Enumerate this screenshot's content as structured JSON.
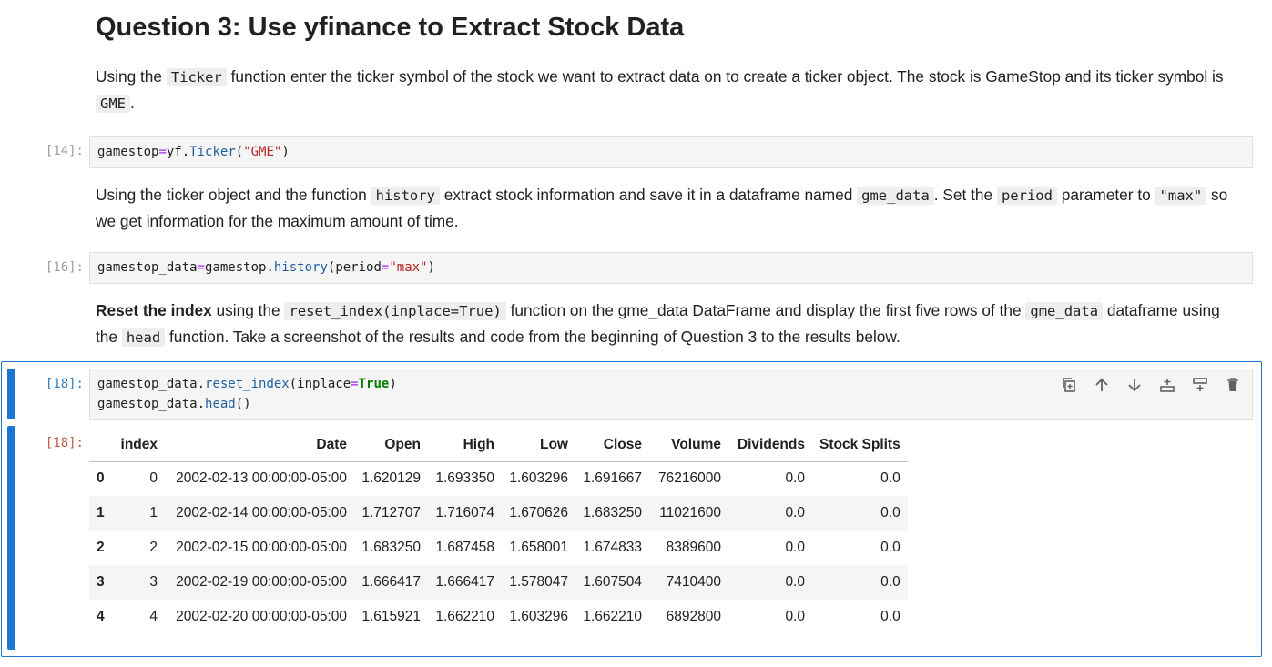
{
  "heading": "Question 3: Use yfinance to Extract Stock Data",
  "para1": {
    "t1": "Using the ",
    "c1": "Ticker",
    "t2": " function enter the ticker symbol of the stock we want to extract data on to create a ticker object. The stock is GameStop and its ticker symbol is ",
    "c2": "GME",
    "t3": "."
  },
  "cell14": {
    "prompt": "[14]:",
    "code": {
      "a": "gamestop",
      "op": "=",
      "b": "yf.",
      "attr": "Ticker",
      "c": "(",
      "str": "\"GME\"",
      "d": ")"
    }
  },
  "para2": {
    "t1": "Using the ticker object and the function ",
    "c1": "history",
    "t2": " extract stock information and save it in a dataframe named ",
    "c2": "gme_data",
    "t3": ". Set the ",
    "c3": "period",
    "t4": " parameter to ",
    "c4": "\"max\"",
    "t5": " so we get information for the maximum amount of time."
  },
  "cell16": {
    "prompt": "[16]:",
    "code": {
      "a": "gamestop_data",
      "op": "=",
      "b": "gamestop.",
      "attr": "history",
      "c": "(period",
      "op2": "=",
      "str": "\"max\"",
      "d": ")"
    }
  },
  "para3": {
    "b1": "Reset the index",
    "t1": " using the ",
    "c1": "reset_index(inplace=True)",
    "t2": " function on the gme_data DataFrame and display the first five rows of the ",
    "c2": "gme_data",
    "t3": " dataframe using the ",
    "c3": "head",
    "t4": " function. Take a screenshot of the results and code from the beginning of Question 3 to the results below."
  },
  "cell18": {
    "prompt_in": "[18]:",
    "prompt_out": "[18]:",
    "line1": {
      "a": "gamestop_data.",
      "attr": "reset_index",
      "b": "(inplace",
      "op": "=",
      "kw": "True",
      "c": ")"
    },
    "line2": {
      "a": "gamestop_data.",
      "attr": "head",
      "b": "()"
    }
  },
  "toolbar_icons": [
    "copy-icon",
    "arrow-up-icon",
    "arrow-down-icon",
    "insert-above-icon",
    "insert-below-icon",
    "trash-icon"
  ],
  "table": {
    "columns": [
      "",
      "index",
      "Date",
      "Open",
      "High",
      "Low",
      "Close",
      "Volume",
      "Dividends",
      "Stock Splits"
    ],
    "rows": [
      [
        "0",
        "0",
        "2002-02-13 00:00:00-05:00",
        "1.620129",
        "1.693350",
        "1.603296",
        "1.691667",
        "76216000",
        "0.0",
        "0.0"
      ],
      [
        "1",
        "1",
        "2002-02-14 00:00:00-05:00",
        "1.712707",
        "1.716074",
        "1.670626",
        "1.683250",
        "11021600",
        "0.0",
        "0.0"
      ],
      [
        "2",
        "2",
        "2002-02-15 00:00:00-05:00",
        "1.683250",
        "1.687458",
        "1.658001",
        "1.674833",
        "8389600",
        "0.0",
        "0.0"
      ],
      [
        "3",
        "3",
        "2002-02-19 00:00:00-05:00",
        "1.666417",
        "1.666417",
        "1.578047",
        "1.607504",
        "7410400",
        "0.0",
        "0.0"
      ],
      [
        "4",
        "4",
        "2002-02-20 00:00:00-05:00",
        "1.615921",
        "1.662210",
        "1.603296",
        "1.662210",
        "6892800",
        "0.0",
        "0.0"
      ]
    ]
  },
  "colors": {
    "accent": "#1976d2",
    "prompt_in_active": "#307fc1",
    "prompt_out": "#bf5b3d",
    "code_bg": "#f5f5f5"
  }
}
